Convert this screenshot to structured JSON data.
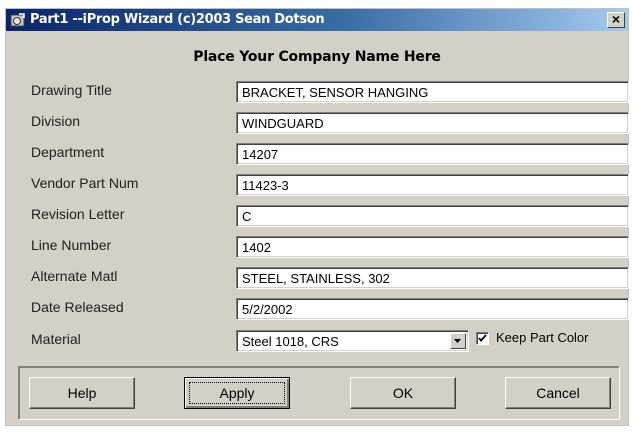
{
  "window": {
    "title": "Part1 --iProp Wizard (c)2003 Sean Dotson",
    "close_label": "×"
  },
  "company_name": "Place Your Company Name Here",
  "fields": [
    {
      "label": "Drawing Title",
      "value": "BRACKET, SENSOR HANGING"
    },
    {
      "label": "Division",
      "value": "WINDGUARD"
    },
    {
      "label": "Department",
      "value": "14207"
    },
    {
      "label": "Vendor Part Num",
      "value": "11423-3"
    },
    {
      "label": "Revision Letter",
      "value": "C"
    },
    {
      "label": "Line Number",
      "value": "1402"
    },
    {
      "label": "Alternate Matl",
      "value": "STEEL, STAINLESS, 302"
    },
    {
      "label": "Date Released",
      "value": "5/2/2002"
    }
  ],
  "material": {
    "label": "Material",
    "selected": "Steel 1018, CRS"
  },
  "keep_part_color": {
    "label": "Keep Part Color",
    "checked": true
  },
  "buttons": {
    "help": "Help",
    "apply": "Apply",
    "ok": "OK",
    "cancel": "Cancel"
  },
  "colors": {
    "title_gradient_start": "#0a246a",
    "title_gradient_end": "#a6caf0",
    "dialog_face": "#d4d0c8"
  },
  "icons": {
    "app_icon": "inventor-app-icon",
    "close": "close-icon",
    "dropdown": "chevron-down-icon",
    "checkbox": "checkmark-icon"
  }
}
